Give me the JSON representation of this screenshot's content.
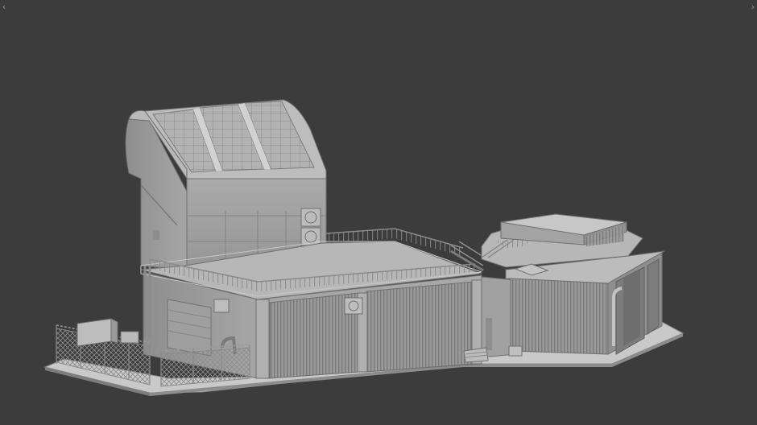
{
  "viewport": {
    "background": "#3c3c3c",
    "model_color": "#a9a9a9",
    "model_light": "#c6c6c6",
    "model_dark": "#6f6f6f",
    "left_chevron_icon": "chevron-left-icon",
    "right_chevron_icon": "chevron-right-icon",
    "left_chevron_glyph": "‹",
    "right_chevron_glyph": "›"
  }
}
